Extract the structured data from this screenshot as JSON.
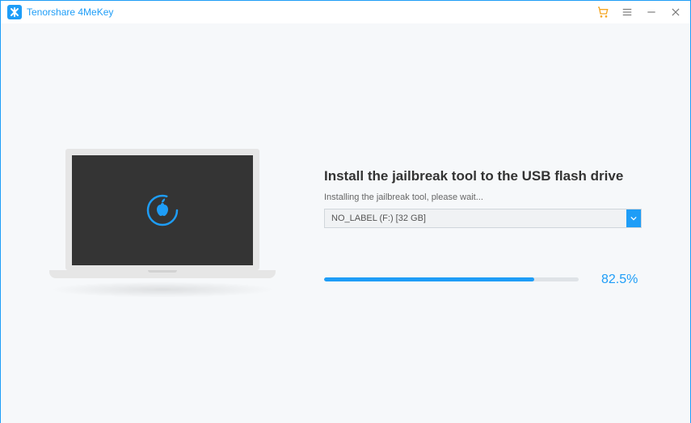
{
  "app": {
    "title": "Tenorshare 4MeKey"
  },
  "main": {
    "heading": "Install the jailbreak tool to the USB flash drive",
    "subtext": "Installing the jailbreak tool, please wait...",
    "drive": {
      "selected": "NO_LABEL (F:) [32 GB]"
    },
    "progress": {
      "pct_label": "82.5%",
      "pct": 82.5
    }
  },
  "colors": {
    "accent": "#1e9df7",
    "cart": "#f5a623"
  }
}
